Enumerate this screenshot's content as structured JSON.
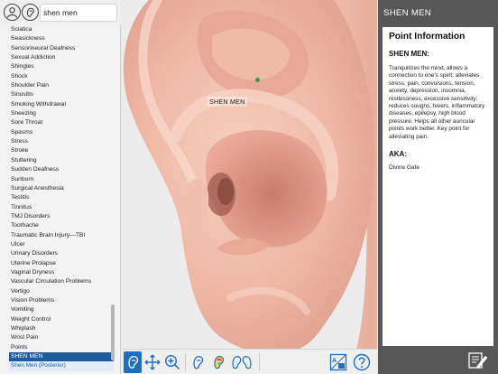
{
  "search": {
    "value": "shen men"
  },
  "conditions": [
    "Sciatica",
    "Seasickness",
    "Sensorineural Deafness",
    "Sexual Addiction",
    "Shingles",
    "Shock",
    "Shoulder Pain",
    "Sinusitis",
    "Smoking Withdrawal",
    "Sneezing",
    "Sore Throat",
    "Spasms",
    "Stress",
    "Stroke",
    "Stuttering",
    "Sudden Deafness",
    "Sunburn",
    "Surgical Anesthesia",
    "Testitis",
    "Tinnitus",
    "TMJ Disorders",
    "Toothache",
    "Traumatic Brain Injury—TBI",
    "Ulcer",
    "Urinary Disorders",
    "Uterine Prolapse",
    "Vaginal Dryness",
    "Vascular Circulation Problems",
    "Vertigo",
    "Vision Problems",
    "Vomiting",
    "Weight Control",
    "Whiplash",
    "Wrist Pain",
    "Points"
  ],
  "selected_point": "SHEN MEN",
  "sub_point": "Shen Men (Posterior)",
  "ear": {
    "point_label": "SHEN MEN"
  },
  "panel": {
    "title": "SHEN MEN",
    "heading": "Point Information",
    "point_name": "SHEN MEN:",
    "description": "Tranquilizes the mind, allows a connection to one's spirit; alleviates stress, pain, convulsions, tension, anxiety, depression, insomnia, restlessness, excessive sensitivity; reduces coughs, fevers, inflammatory diseases, epilepsy, high blood pressure. Helps all other auricular points work better. Key point for alleviating pain.",
    "aka_heading": "AKA:",
    "aka_value": "Divine Gate"
  },
  "toolbar": {
    "icons": [
      "ear-view-icon",
      "pan-icon",
      "zoom-in-icon",
      "ear-outline-icon",
      "ear-color-icon",
      "ear-pair-icon",
      "help-icon"
    ]
  },
  "colors": {
    "accent": "#1f5a9b",
    "toolbar_active": "#1e6fc2",
    "point_marker": "#2aa34a",
    "panel_bg": "#575757"
  }
}
